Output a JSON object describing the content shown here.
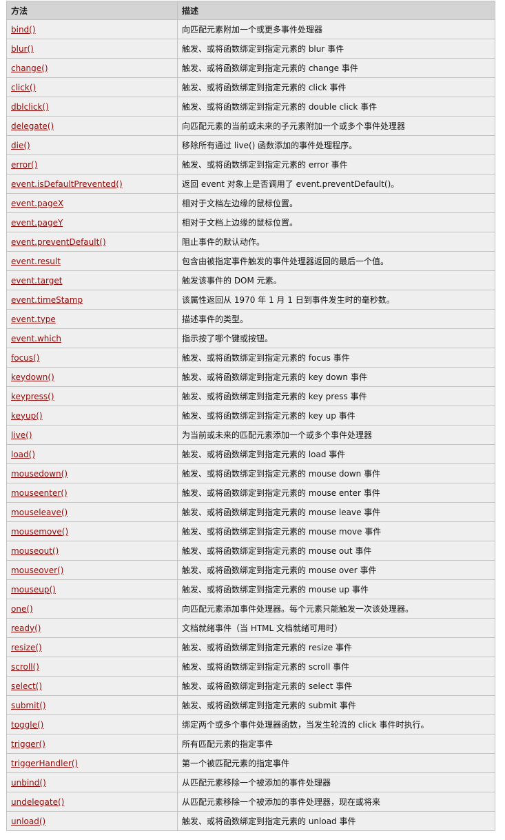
{
  "table": {
    "headers": [
      "方法",
      "描述"
    ],
    "rows": [
      {
        "method": "bind()",
        "desc": "向匹配元素附加一个或更多事件处理器"
      },
      {
        "method": "blur()",
        "desc": "触发、或将函数绑定到指定元素的 blur 事件"
      },
      {
        "method": "change()",
        "desc": "触发、或将函数绑定到指定元素的 change 事件"
      },
      {
        "method": "click()",
        "desc": "触发、或将函数绑定到指定元素的 click 事件"
      },
      {
        "method": "dblclick()",
        "desc": "触发、或将函数绑定到指定元素的 double click 事件"
      },
      {
        "method": "delegate()",
        "desc": "向匹配元素的当前或未来的子元素附加一个或多个事件处理器"
      },
      {
        "method": "die()",
        "desc": "移除所有通过 live() 函数添加的事件处理程序。"
      },
      {
        "method": "error()",
        "desc": "触发、或将函数绑定到指定元素的 error 事件"
      },
      {
        "method": "event.isDefaultPrevented()",
        "desc": "返回 event 对象上是否调用了 event.preventDefault()。"
      },
      {
        "method": "event.pageX",
        "desc": "相对于文档左边缘的鼠标位置。"
      },
      {
        "method": "event.pageY",
        "desc": "相对于文档上边缘的鼠标位置。"
      },
      {
        "method": "event.preventDefault()",
        "desc": "阻止事件的默认动作。"
      },
      {
        "method": "event.result",
        "desc": "包含由被指定事件触发的事件处理器返回的最后一个值。"
      },
      {
        "method": "event.target",
        "desc": "触发该事件的 DOM 元素。"
      },
      {
        "method": "event.timeStamp",
        "desc": "该属性返回从 1970 年 1 月 1 日到事件发生时的毫秒数。"
      },
      {
        "method": "event.type",
        "desc": "描述事件的类型。"
      },
      {
        "method": "event.which",
        "desc": "指示按了哪个键或按钮。"
      },
      {
        "method": "focus()",
        "desc": "触发、或将函数绑定到指定元素的 focus 事件"
      },
      {
        "method": "keydown()",
        "desc": "触发、或将函数绑定到指定元素的 key down 事件"
      },
      {
        "method": "keypress()",
        "desc": "触发、或将函数绑定到指定元素的 key press 事件"
      },
      {
        "method": "keyup()",
        "desc": "触发、或将函数绑定到指定元素的 key up 事件"
      },
      {
        "method": "live()",
        "desc": "为当前或未来的匹配元素添加一个或多个事件处理器"
      },
      {
        "method": "load()",
        "desc": "触发、或将函数绑定到指定元素的 load 事件"
      },
      {
        "method": "mousedown()",
        "desc": "触发、或将函数绑定到指定元素的 mouse down 事件"
      },
      {
        "method": "mouseenter()",
        "desc": "触发、或将函数绑定到指定元素的 mouse enter 事件"
      },
      {
        "method": "mouseleave()",
        "desc": "触发、或将函数绑定到指定元素的 mouse leave 事件"
      },
      {
        "method": "mousemove()",
        "desc": "触发、或将函数绑定到指定元素的 mouse move 事件"
      },
      {
        "method": "mouseout()",
        "desc": "触发、或将函数绑定到指定元素的 mouse out 事件"
      },
      {
        "method": "mouseover()",
        "desc": "触发、或将函数绑定到指定元素的 mouse over 事件"
      },
      {
        "method": "mouseup()",
        "desc": "触发、或将函数绑定到指定元素的 mouse up 事件"
      },
      {
        "method": "one()",
        "desc": "向匹配元素添加事件处理器。每个元素只能触发一次该处理器。"
      },
      {
        "method": "ready()",
        "desc": "文档就绪事件（当 HTML 文档就绪可用时）"
      },
      {
        "method": "resize()",
        "desc": "触发、或将函数绑定到指定元素的 resize 事件"
      },
      {
        "method": "scroll()",
        "desc": "触发、或将函数绑定到指定元素的 scroll 事件"
      },
      {
        "method": "select()",
        "desc": "触发、或将函数绑定到指定元素的 select 事件"
      },
      {
        "method": "submit()",
        "desc": "触发、或将函数绑定到指定元素的 submit 事件"
      },
      {
        "method": "toggle()",
        "desc": "绑定两个或多个事件处理器函数，当发生轮流的 click 事件时执行。"
      },
      {
        "method": "trigger()",
        "desc": "所有匹配元素的指定事件"
      },
      {
        "method": "triggerHandler()",
        "desc": "第一个被匹配元素的指定事件"
      },
      {
        "method": "unbind()",
        "desc": "从匹配元素移除一个被添加的事件处理器"
      },
      {
        "method": "undelegate()",
        "desc": "从匹配元素移除一个被添加的事件处理器，现在或将来"
      },
      {
        "method": "unload()",
        "desc": "触发、或将函数绑定到指定元素的 unload 事件"
      }
    ]
  },
  "colors": {
    "link": "#900b09",
    "header_bg": "#d4d4d4",
    "row_bg": "#efefef",
    "border": "#c3c3c3"
  }
}
